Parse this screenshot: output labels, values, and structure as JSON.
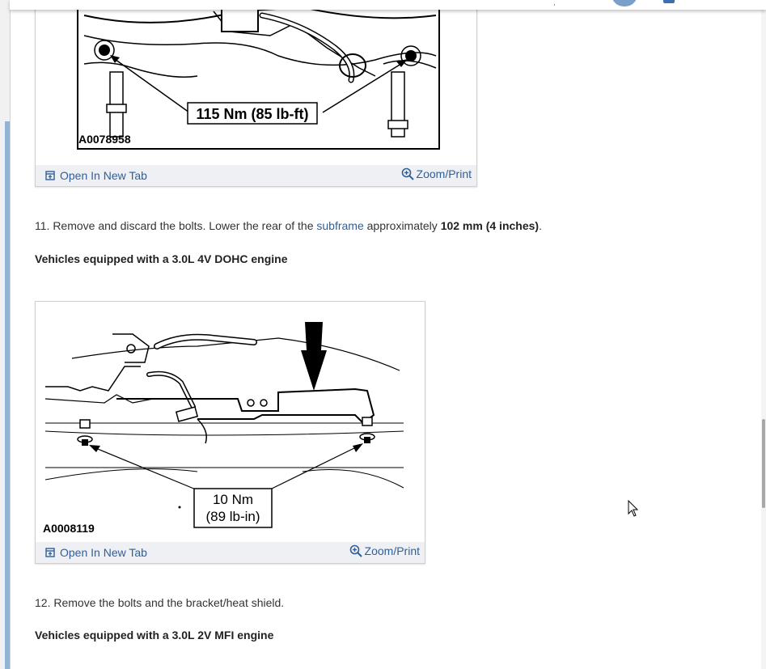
{
  "figure1": {
    "code": "A0078958",
    "torque": "115 Nm (85 lb-ft)",
    "open_tab_label": "Open In New Tab",
    "zoom_label": "Zoom/Print"
  },
  "step11": {
    "prefix": "11. Remove and discard the bolts. Lower the rear of the ",
    "link": "subframe",
    "middle": " approximately ",
    "bold": "102 mm (4 inches)",
    "suffix": "."
  },
  "heading1": "Vehicles equipped with a 3.0L 4V DOHC engine",
  "figure2": {
    "code": "A0008119",
    "torque_line1": "10 Nm",
    "torque_line2": "(89 lb-in)",
    "open_tab_label": "Open In New Tab",
    "zoom_label": "Zoom/Print"
  },
  "step12": "12. Remove the bolts and the bracket/heat shield.",
  "heading2": "Vehicles equipped with a 3.0L 2V MFI engine",
  "colors": {
    "link": "#2f5f9a",
    "toolbar_bg": "#eef0f4",
    "text": "#333333"
  }
}
